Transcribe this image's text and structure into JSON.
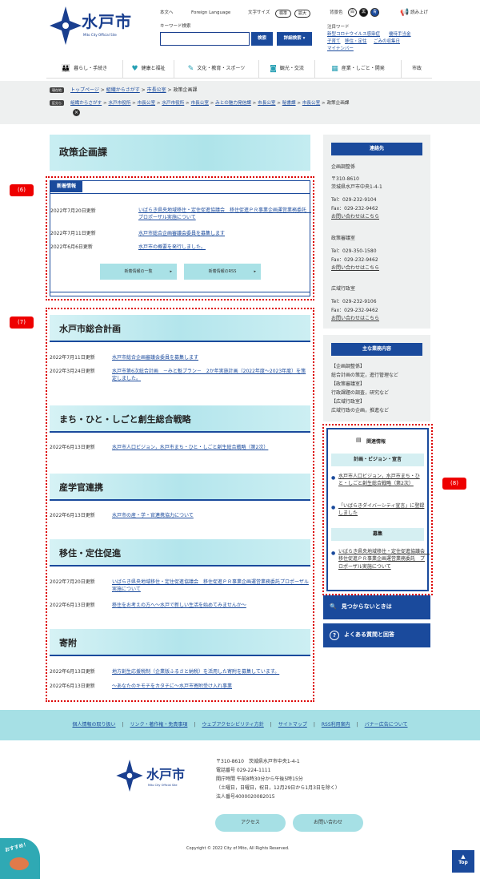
{
  "header": {
    "logo_text": "水戸市",
    "logo_sub": "Mito City Official Site",
    "links": [
      "本文へ",
      "Foreign Language"
    ],
    "font_size_label": "文字サイズ",
    "font_opts": [
      "標準",
      "拡大"
    ],
    "bg_color_label": "背景色",
    "colors": [
      "白",
      "黒",
      "青"
    ],
    "read_label": "読み上げ",
    "keyword_label": "キーワード検索",
    "search_button": "検索",
    "detail_search": "詳細検索",
    "hot_words_label": "注目ワード",
    "hot_words": [
      "新型コロナウイルス感染症",
      "優待手当金",
      "子育て",
      "移住・定住",
      "ごみの収集日",
      "マイナンバー"
    ]
  },
  "nav": [
    "暮らし・手続き",
    "健康と福祉",
    "文化・教育・スポーツ",
    "観光・交流",
    "産業・しごと・開発",
    "市政"
  ],
  "breadcrumb": {
    "tag1": "現在地",
    "row1": [
      "トップページ",
      "組織からさがす",
      "市長公室",
      "政策企画課"
    ],
    "tag2": "区分ら",
    "row2": [
      "組織からさがす",
      "水戸市役所",
      "市長公室",
      "水戸市役所",
      "市長公室",
      "みとの魅力発信課",
      "市長公室",
      "秘書課",
      "市長公室",
      "政策企画課"
    ]
  },
  "page_title": "政策企画課",
  "news": {
    "tab": "新着情報",
    "items": [
      {
        "date": "2022年7月20日更新",
        "text": "いばらき県央地域移住・定住促進協議会　移住促進ＰＲ事業企画運営業務委託　プロポーザル実施について"
      },
      {
        "date": "2022年7月11日更新",
        "text": "水戸市総合企画審議会委員を募集します"
      },
      {
        "date": "2022年6月6日更新",
        "text": "水戸市の概要を発行しました。"
      }
    ],
    "btn_list": "新着情報の一覧",
    "btn_rss": "新着情報のRSS"
  },
  "sections": [
    {
      "title": "水戸市総合計画",
      "items": [
        {
          "date": "2022年7月11日更新",
          "text": "水戸市総合企画審議会委員を募集します"
        },
        {
          "date": "2022年3月24日更新",
          "text": "水戸市第6次総合計画　－みと魁プラン－　2か年実施計画（2022年度～2023年度）を策定しました。"
        }
      ]
    },
    {
      "title": "まち・ひと・しごと創生総合戦略",
      "items": [
        {
          "date": "2022年6月13日更新",
          "text": "水戸市人口ビジョン，水戸市まち・ひと・しごと創生総合戦略（第2次）"
        }
      ]
    },
    {
      "title": "産学官連携",
      "items": [
        {
          "date": "2022年6月13日更新",
          "text": "水戸市の産・学・官連携協力について"
        }
      ]
    },
    {
      "title": "移住・定住促進",
      "items": [
        {
          "date": "2022年7月20日更新",
          "text": "いばらき県央地域移住・定住促進協議会　移住促進ＰＲ事業企画運営業務委託プロポーザル実施について"
        },
        {
          "date": "2022年6月13日更新",
          "text": "移住をお考えの方へ～水戸で新しい生活を始めてみませんか～"
        }
      ]
    },
    {
      "title": "寄附",
      "items": [
        {
          "date": "2022年6月13日更新",
          "text": "地方創生応援税制（企業版ふるさと納税）を活用した寄附を募集しています。"
        },
        {
          "date": "2022年6月13日更新",
          "text": "～あなたのキモチをカタチに～水戸市寄附受け入れ事業"
        }
      ]
    }
  ],
  "contact": {
    "title": "連絡先",
    "dept1": "企画調整係",
    "addr": [
      "〒310-8610",
      "茨城県水戸市中央1-4-1"
    ],
    "tel1": "Tel：029-232-9104",
    "fax1": "Fax：029-232-9462",
    "form": "お問い合わせはこちら",
    "dept2": "政策審議室",
    "tel2": "Tel：029-350-1580",
    "fax2": "Fax：029-232-9462",
    "dept3": "広域行政室",
    "tel3": "Tel：029-232-9106",
    "fax3": "Fax：029-232-9462"
  },
  "duties": {
    "title": "主な業務内容",
    "lines": [
      "【企画調整係】",
      "総合計画の策定，進行管理など",
      "【政策審議室】",
      "行政課題の調査，研究など",
      "【広域行政室】",
      "広域行政の企画，推進など"
    ]
  },
  "related": {
    "title": "関連情報",
    "cat1": "計画・ビジョン・宣言",
    "items1": [
      "水戸市人口ビジョン，水戸市まち・ひと・しごと創生総合戦略（第2次）",
      "「いばらきダイバーシティ宣言」に登録しました"
    ],
    "cat2": "募集",
    "items2": [
      "いばらき県央地域移住・定住促進協議会　移住促進ＰＲ事業企画運営業務委託　プロポーザル実施について"
    ]
  },
  "side_buttons": [
    "見つからないときは",
    "よくある質問と回答"
  ],
  "markers": [
    "(6)",
    "(7)",
    "(8)"
  ],
  "footer": {
    "links": [
      "個人情報の取り扱い",
      "リンク・著作権・免責事項",
      "ウェブアクセシビリティ方針",
      "サイトマップ",
      "RSS利用案内",
      "バナー広告について"
    ],
    "logo_text": "水戸市",
    "logo_sub": "Mito City Official Site",
    "info": [
      "〒310-8610　茨城県水戸市中央1-4-1",
      "電話番号 029-224-1111",
      "開庁時間 午前8時30分から午後5時15分",
      "（土曜日，日曜日，祝日，12月29日から1月3日を除く）",
      "法人番号4000020082015"
    ],
    "access": "アクセス",
    "contact": "お問い合わせ",
    "copyright": "Copyright © 2022 City of Mito, All Rights Reserved.",
    "top": "Top",
    "recommend": "おすすめ！"
  }
}
